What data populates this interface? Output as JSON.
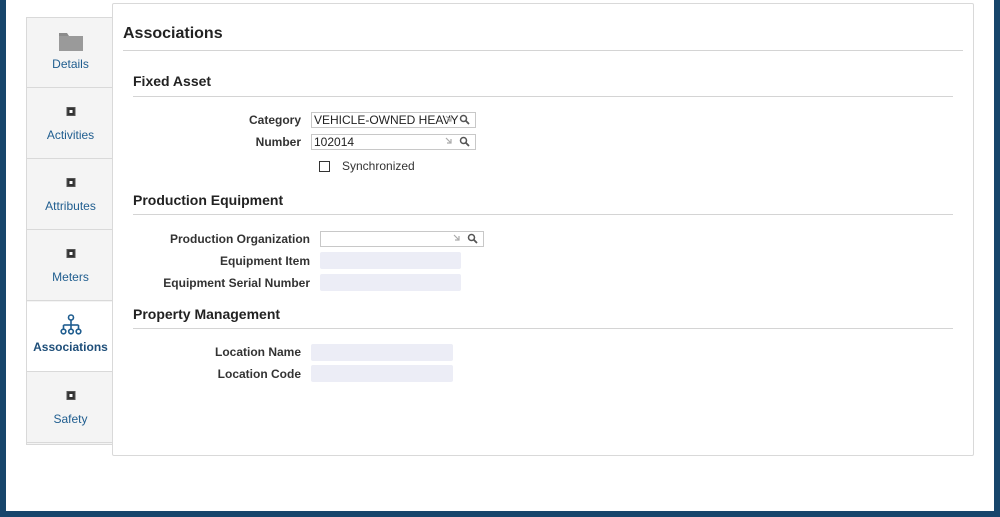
{
  "tabs": [
    {
      "label": "Details",
      "icon": "folder-icon"
    },
    {
      "label": "Activities",
      "icon": "activities-icon"
    },
    {
      "label": "Attributes",
      "icon": "attributes-icon"
    },
    {
      "label": "Meters",
      "icon": "meters-icon"
    },
    {
      "label": "Associations",
      "icon": "hierarchy-icon",
      "selected": true
    },
    {
      "label": "Safety",
      "icon": "safety-icon"
    }
  ],
  "panel": {
    "title": "Associations",
    "fixed_asset": {
      "title": "Fixed Asset",
      "category_label": "Category",
      "category_value": "VEHICLE-OWNED HEAVY",
      "number_label": "Number",
      "number_value": "102014",
      "synchronized_label": "Synchronized",
      "synchronized_checked": false
    },
    "production_equipment": {
      "title": "Production Equipment",
      "organization_label": "Production Organization",
      "organization_value": "",
      "equipment_item_label": "Equipment Item",
      "equipment_item_value": "",
      "serial_label": "Equipment Serial Number",
      "serial_value": ""
    },
    "property_management": {
      "title": "Property Management",
      "location_name_label": "Location Name",
      "location_name_value": "",
      "location_code_label": "Location Code",
      "location_code_value": ""
    }
  },
  "colors": {
    "accent": "#1f5d8f",
    "frame_border": "#17456b",
    "readonly_field": "#ecedf6"
  }
}
